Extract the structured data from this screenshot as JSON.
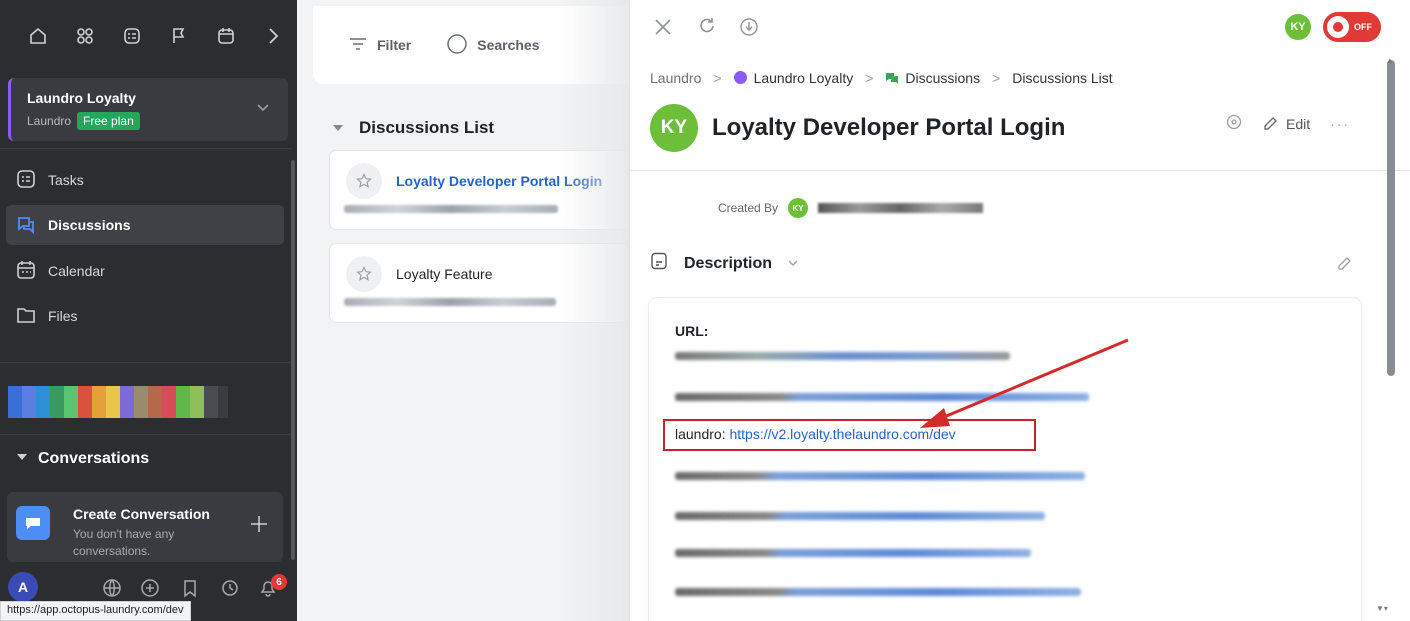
{
  "sidebar": {
    "workspace": {
      "name": "Laundro Loyalty",
      "org": "Laundro",
      "plan": "Free plan"
    },
    "nav": [
      {
        "label": "Tasks",
        "icon": "tasks-icon"
      },
      {
        "label": "Discussions",
        "icon": "discussions-icon",
        "active": true
      },
      {
        "label": "Calendar",
        "icon": "calendar-icon"
      },
      {
        "label": "Files",
        "icon": "folder-icon"
      }
    ],
    "conversations_heading": "Conversations",
    "create_conversation": {
      "title": "Create Conversation",
      "subtitle": "You don't have any conversations."
    },
    "user_initial": "A",
    "notifications_count": "6"
  },
  "status_url": "https://app.octopus-laundry.com/dev",
  "middle": {
    "filter_label": "Filter",
    "searches_label": "Searches",
    "list_heading": "Discussions List",
    "items": [
      {
        "title": "Loyalty Developer Portal Login",
        "active": true
      },
      {
        "title": "Loyalty Feature",
        "active": false
      }
    ]
  },
  "panel": {
    "user_initials": "KY",
    "record_toggle": "OFF",
    "breadcrumb": [
      "Laundro",
      "Laundro Loyalty",
      "Discussions",
      "Discussions List"
    ],
    "title": "Loyalty Developer Portal Login",
    "edit_label": "Edit",
    "created_by_label": "Created By",
    "description_label": "Description",
    "url_label": "URL:",
    "highlighted_prefix": "laundro: ",
    "highlighted_url": "https://v2.loyalty.thelaundro.com/dev"
  },
  "colors": {
    "sidebar_bg": "#2b2d31",
    "accent_blue": "#3b82f6",
    "free_plan_green": "#22a75b",
    "avatar_green": "#6dbf3a",
    "record_red": "#e03a36",
    "annotation_red": "#d42a2a"
  }
}
